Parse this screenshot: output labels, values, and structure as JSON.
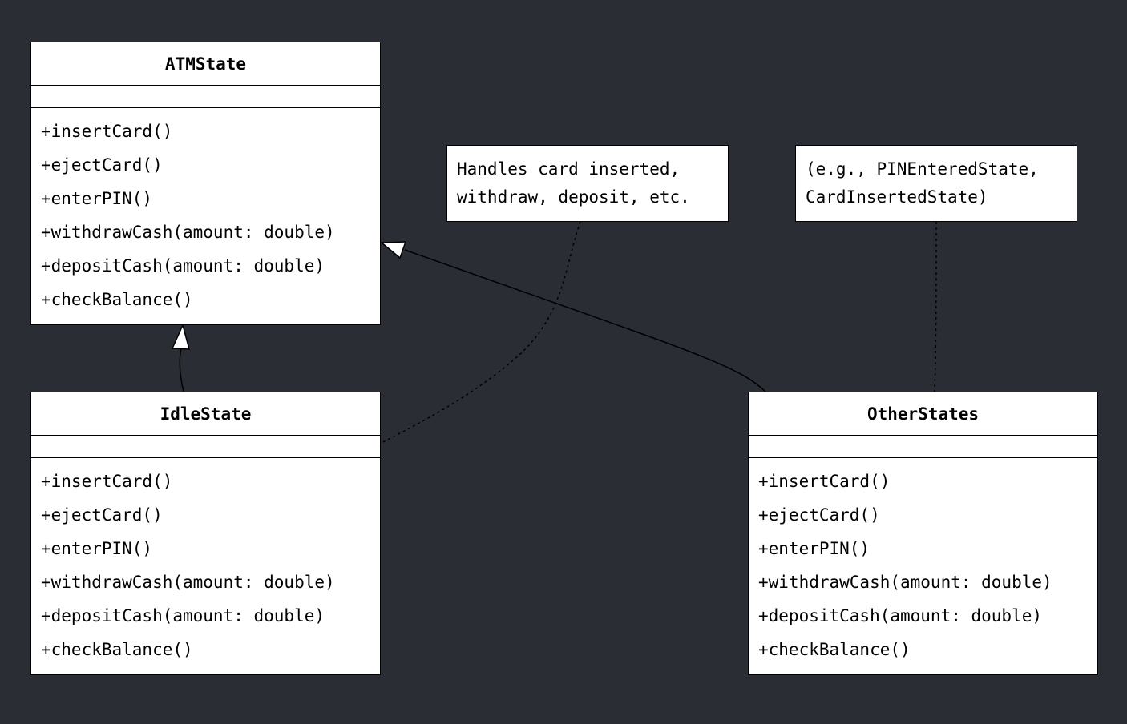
{
  "diagram": {
    "background_color": "#2a2d34",
    "classes": [
      {
        "name": "ATMState",
        "methods": [
          "+insertCard()",
          "+ejectCard()",
          "+enterPIN()",
          "+withdrawCash(amount: double)",
          "+depositCash(amount: double)",
          "+checkBalance()"
        ]
      },
      {
        "name": "IdleState",
        "methods": [
          "+insertCard()",
          "+ejectCard()",
          "+enterPIN()",
          "+withdrawCash(amount: double)",
          "+depositCash(amount: double)",
          "+checkBalance()"
        ]
      },
      {
        "name": "OtherStates",
        "methods": [
          "+insertCard()",
          "+ejectCard()",
          "+enterPIN()",
          "+withdrawCash(amount: double)",
          "+depositCash(amount: double)",
          "+checkBalance()"
        ]
      }
    ],
    "notes": [
      {
        "lines": [
          "Handles card inserted,",
          "withdraw, deposit, etc."
        ]
      },
      {
        "lines": [
          "(e.g., PINEnteredState,",
          "CardInsertedState)"
        ]
      }
    ]
  }
}
